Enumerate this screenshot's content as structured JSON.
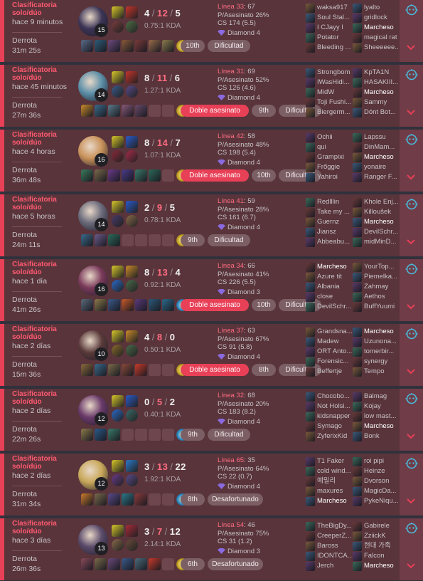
{
  "colors": {
    "loss_bg": "#59343b",
    "loss_accent": "#e84057",
    "death_red": "#ff6c81"
  },
  "matches": [
    {
      "queue": [
        "Clasificatoria",
        "solo/dúo"
      ],
      "ago": "hace 9 minutos",
      "result": "Derrota",
      "duration": "31m 25s",
      "champ_color": "#3c3556",
      "level": "15",
      "spells": [
        "#d7c72a",
        "#c7332c"
      ],
      "runes": [
        "#7a3d3d",
        "#4e6e46"
      ],
      "kda": {
        "k": "4",
        "d": "12",
        "a": "5"
      },
      "ratio": "0.75:1 KDA",
      "lane": "Línea 33",
      "lane_val": ": 67",
      "kp": "P/Asesinato 26%",
      "cs": "CS 174 (5.5)",
      "rank": "Diamond 4",
      "items": [
        "#5a6b8a",
        "#2e5c7a",
        "#6e4a7e",
        "#8a5a3a",
        "#7a3a3a",
        "#9a6b4a",
        "#8a7a4a"
      ],
      "ward": "#c9a827",
      "badges": [
        {
          "text": "10th",
          "style": "grey"
        },
        {
          "text": "Dificultad",
          "style": "grey"
        }
      ],
      "team1": [
        "waksa917",
        "Soul Stal...",
        "I CJayy I",
        "Potator",
        "Bleeding ..."
      ],
      "team2": [
        "lyalto",
        "gridlock",
        "Marcheso",
        "magical rat",
        "Sheeeeee..."
      ],
      "me": [
        2,
        2
      ]
    },
    {
      "queue": [
        "Clasificatoria",
        "solo/dúo"
      ],
      "ago": "hace 45 minutos",
      "result": "Derrota",
      "duration": "27m 36s",
      "champ_color": "#5c8fa8",
      "level": "14",
      "spells": [
        "#d7c72a",
        "#c7332c"
      ],
      "runes": [
        "#3a5a8a",
        "#5a4a8a"
      ],
      "kda": {
        "k": "8",
        "d": "11",
        "a": "6"
      },
      "ratio": "1.27:1 KDA",
      "lane": "Línea 31",
      "lane_val": ": 69",
      "kp": "P/Asesinato 52%",
      "cs": "CS 126 (4.6)",
      "rank": "Diamond 4",
      "items": [
        "#c98a2a",
        "#3a6a8a",
        "#5a7a8a",
        "#8a5a7a",
        "#6a4a6a",
        null,
        null
      ],
      "ward": "#c9a827",
      "badges": [
        {
          "text": "Doble asesinato",
          "style": "red"
        },
        {
          "text": "9th",
          "style": "grey"
        },
        {
          "text": "Dificultad",
          "style": "grey"
        }
      ],
      "team1": [
        "Strongbom",
        "IWasHidi...",
        "MidW",
        "Toji Fushi...",
        "Biergerm..."
      ],
      "team2": [
        "KpTA1N",
        "HASAKIII...",
        "Marcheso",
        "Sammy",
        "Dónt Bot..."
      ],
      "me": [
        2,
        2
      ]
    },
    {
      "queue": [
        "Clasificatoria",
        "solo/dúo"
      ],
      "ago": "hace 4 horas",
      "result": "Derrota",
      "duration": "36m 48s",
      "champ_color": "#c9925a",
      "level": "16",
      "spells": [
        "#d7c72a",
        "#2a5ac9"
      ],
      "runes": [
        "#8a2a3a",
        "#a82a4a"
      ],
      "kda": {
        "k": "8",
        "d": "14",
        "a": "7"
      },
      "ratio": "1.07:1 KDA",
      "lane": "Línea 42",
      "lane_val": ": 58",
      "kp": "P/Asesinato 48%",
      "cs": "CS 198 (5.4)",
      "rank": "Diamond 4",
      "items": [
        "#3a7a5a",
        "#7a6a4a",
        "#6a3a8a",
        "#4a3a8a",
        "#3a7a6a",
        "#2a6a5a",
        null
      ],
      "ward": "#c9a827",
      "badges": [
        {
          "text": "Doble asesinato",
          "style": "red"
        },
        {
          "text": "10th",
          "style": "grey"
        },
        {
          "text": "Dificultad",
          "style": "grey"
        }
      ],
      "team1": [
        "Ochii",
        "qui",
        "Grampixi",
        "Frőggie",
        "Yahiroi"
      ],
      "team2": [
        "Lapssu",
        "DinMam...",
        "Marcheso",
        "yonaire",
        "Ranger F..."
      ],
      "me": [
        2,
        2
      ]
    },
    {
      "queue": [
        "Clasificatoria",
        "solo/dúo"
      ],
      "ago": "hace 5 horas",
      "result": "Derrota",
      "duration": "24m 11s",
      "champ_color": "#6a6a7a",
      "level": "14",
      "spells": [
        "#d7c72a",
        "#2a5ac9"
      ],
      "runes": [
        "#4a3a6a",
        "#8a6a4a"
      ],
      "kda": {
        "k": "2",
        "d": "9",
        "a": "5"
      },
      "ratio": "0.78:1 KDA",
      "lane": "Línea 41",
      "lane_val": ": 59",
      "kp": "P/Asesinato 28%",
      "cs": "CS 161 (6.7)",
      "rank": "Diamond 4",
      "items": [
        "#3a6a8a",
        "#6a5a8a",
        "#2a6a5a",
        null,
        null,
        null,
        null
      ],
      "ward": "#c9a827",
      "badges": [
        {
          "text": "9th",
          "style": "grey"
        },
        {
          "text": "Dificultad",
          "style": "grey"
        }
      ],
      "team1": [
        "Redlllin",
        "Take my ...",
        "Guernz",
        "Jiansz",
        "Abbeabu..."
      ],
      "team2": [
        "Khole Enj...",
        "Killoušek",
        "Marcheso",
        "DevilSchr...",
        "midMinD..."
      ],
      "me": [
        2,
        2
      ]
    },
    {
      "queue": [
        "Clasificatoria",
        "solo/dúo"
      ],
      "ago": "hace 1 día",
      "result": "Derrota",
      "duration": "41m 26s",
      "champ_color": "#7a3a5a",
      "level": "16",
      "spells": [
        "#d7c72a",
        "#c98a2a"
      ],
      "runes": [
        "#2a6ac9",
        "#4a6a4a"
      ],
      "kda": {
        "k": "8",
        "d": "13",
        "a": "4"
      },
      "ratio": "0.92:1 KDA",
      "lane": "Línea 34",
      "lane_val": ": 66",
      "kp": "P/Asesinato 41%",
      "cs": "CS 226 (5.5)",
      "rank": "Diamond 3",
      "items": [
        "#5a6a7a",
        "#8a7a4a",
        "#3a5a8a",
        "#c95a2a",
        "#5a3a7a",
        "#2a5a7a",
        "#2a6a8a"
      ],
      "ward": "#2a8ac9",
      "badges": [
        {
          "text": "Doble asesinato",
          "style": "red"
        },
        {
          "text": "10th",
          "style": "grey"
        },
        {
          "text": "Dificultad",
          "style": "grey"
        }
      ],
      "team1": [
        "Marcheso",
        "Azure tit",
        "Albania",
        "close",
        "DevilSchr..."
      ],
      "team2": [
        "YourTop...",
        "Piemelka...",
        "Zahmay",
        "Aethos",
        "BuffYuumi"
      ],
      "me": [
        1,
        0
      ]
    },
    {
      "queue": [
        "Clasificatoria",
        "solo/dúo"
      ],
      "ago": "hace 2 días",
      "result": "Derrota",
      "duration": "15m 36s",
      "champ_color": "#5a3a3a",
      "level": "10",
      "spells": [
        "#d7c72a",
        "#c98a2a"
      ],
      "runes": [
        "#8a6a2a",
        "#4a6a4a"
      ],
      "kda": {
        "k": "4",
        "d": "8",
        "a": "0"
      },
      "ratio": "0.50:1 KDA",
      "lane": "Línea 37",
      "lane_val": ": 63",
      "kp": "P/Asesinato 67%",
      "cs": "CS 91 (5.8)",
      "rank": "Diamond 4",
      "items": [
        "#8a6a3a",
        "#3a6a8a",
        "#7a6a4a",
        "#8a4a3a",
        "#c93a2a",
        null,
        null
      ],
      "ward": "#c9a827",
      "badges": [
        {
          "text": "Doble asesinato",
          "style": "red"
        },
        {
          "text": "8th",
          "style": "grey"
        },
        {
          "text": "Dificultad",
          "style": "grey"
        }
      ],
      "team1": [
        "Grandsna...",
        "Madew",
        "ORT Anto...",
        "Forensic...",
        "Beffertje"
      ],
      "team2": [
        "Marcheso",
        "Uzunona...",
        "tomerbir...",
        "synergy",
        "Tempo"
      ],
      "me": [
        2,
        0
      ]
    },
    {
      "queue": [
        "Clasificatoria",
        "solo/dúo"
      ],
      "ago": "hace 2 días",
      "result": "Derrota",
      "duration": "22m 26s",
      "champ_color": "#6a3a6a",
      "level": "12",
      "spells": [
        "#d7c72a",
        "#2a5ac9"
      ],
      "runes": [
        "#2a6ac9",
        "#3a6a6a"
      ],
      "kda": {
        "k": "0",
        "d": "5",
        "a": "2"
      },
      "ratio": "0.40:1 KDA",
      "lane": "Línea 32",
      "lane_val": ": 68",
      "kp": "P/Asesinato 20%",
      "cs": "CS 183 (8.2)",
      "rank": "Diamond 4",
      "items": [
        "#8a7a4a",
        "#2a5a8a",
        "#3a7a6a",
        null,
        null,
        null,
        null
      ],
      "ward": "#2a8ac9",
      "badges": [
        {
          "text": "9th",
          "style": "grey"
        },
        {
          "text": "Dificultad",
          "style": "grey"
        }
      ],
      "team1": [
        "Chocobo...",
        "Not Holsi...",
        "kidsnapper",
        "Symago",
        "ZyferixKid"
      ],
      "team2": [
        "Balmag",
        "Kojay",
        "low mast...",
        "Marcheso",
        "Bonk"
      ],
      "me": [
        2,
        3
      ]
    },
    {
      "queue": [
        "Clasificatoria",
        "solo/dúo"
      ],
      "ago": "hace 2 días",
      "result": "Derrota",
      "duration": "31m 34s",
      "champ_color": "#c9a85a",
      "level": "12",
      "spells": [
        "#d7c72a",
        "#2a7ac9"
      ],
      "runes": [
        "#6a3a8a",
        "#5a4a8a"
      ],
      "kda": {
        "k": "3",
        "d": "13",
        "a": "22"
      },
      "ratio": "1.92:1 KDA",
      "lane": "Línea 65",
      "lane_val": ": 35",
      "kp": "P/Asesinato 64%",
      "cs": "CS 22 (0.7)",
      "rank": "Diamond 4",
      "items": [
        "#c97a2a",
        "#7a6a4a",
        "#5a4a8a",
        "#2a7a8a",
        "#8a3a3a",
        null,
        null
      ],
      "ward": "#2a8ac9",
      "badges": [
        {
          "text": "8th",
          "style": "grey"
        },
        {
          "text": "Desafortunado",
          "style": "grey"
        }
      ],
      "team1": [
        "T1 Faker",
        "cold wind...",
        "예밀리",
        "maxures",
        "Marcheso"
      ],
      "team2": [
        "roi pipi",
        "Heinze",
        "Dvorson",
        "MagicDa...",
        "PykeNiqu..."
      ],
      "me": [
        1,
        4
      ]
    },
    {
      "queue": [
        "Clasificatoria",
        "solo/dúo"
      ],
      "ago": "hace 3 días",
      "result": "Derrota",
      "duration": "26m 36s",
      "champ_color": "#5a4a6a",
      "level": "13",
      "spells": [
        "#d7c72a",
        "#a82a3a"
      ],
      "runes": [
        "#8a6a4a",
        "#6a4a3a"
      ],
      "kda": {
        "k": "3",
        "d": "7",
        "a": "12"
      },
      "ratio": "2.14:1 KDA",
      "lane": "Línea 54",
      "lane_val": ": 46",
      "kp": "P/Asesinato 75%",
      "cs": "CS 31 (1.2)",
      "rank": "Diamond 3",
      "items": [
        "#8a4a5a",
        "#7a6a4a",
        "#6a4a7a",
        "#3a5a8a",
        "#4a6a7a",
        "#c93a2a",
        null
      ],
      "ward": "#c9a827",
      "badges": [
        {
          "text": "6th",
          "style": "grey"
        },
        {
          "text": "Desafortunado",
          "style": "grey"
        }
      ],
      "team1": [
        "TheBigDy...",
        "CreeperZ...",
        "Baross",
        "IDONTCA...",
        "Jerch"
      ],
      "team2": [
        "Gabirele",
        "ZziickK",
        "현대 가족",
        "Falcon",
        "Marcheso"
      ],
      "me": [
        2,
        4
      ]
    }
  ]
}
